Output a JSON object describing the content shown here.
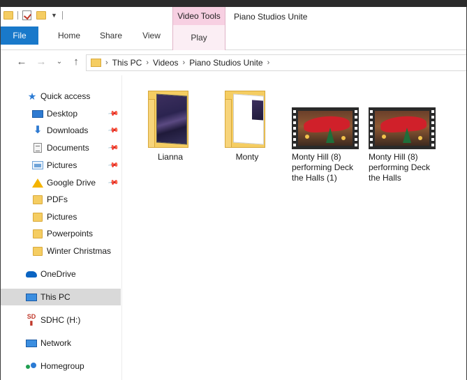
{
  "titlebar": {
    "video_tools_label": "Video Tools",
    "window_title": "Piano Studios Unite"
  },
  "ribbon": {
    "tabs": [
      "File",
      "Home",
      "Share",
      "View",
      "Play"
    ]
  },
  "address": {
    "crumbs": [
      "This PC",
      "Videos",
      "Piano Studios Unite"
    ]
  },
  "navpane": {
    "items": [
      {
        "label": "Quick access",
        "icon": "quick-access-star-icon"
      },
      {
        "label": "Desktop",
        "icon": "desktop-icon",
        "pinned": true
      },
      {
        "label": "Downloads",
        "icon": "downloads-icon",
        "pinned": true
      },
      {
        "label": "Documents",
        "icon": "documents-icon",
        "pinned": true
      },
      {
        "label": "Pictures",
        "icon": "pictures-icon",
        "pinned": true
      },
      {
        "label": "Google Drive",
        "icon": "google-drive-icon",
        "pinned": true
      },
      {
        "label": "PDFs",
        "icon": "folder-icon"
      },
      {
        "label": "Pictures",
        "icon": "folder-icon"
      },
      {
        "label": "Powerpoints",
        "icon": "folder-icon"
      },
      {
        "label": "Winter Christmas",
        "icon": "folder-icon"
      },
      {
        "label": "OneDrive",
        "icon": "onedrive-icon"
      },
      {
        "label": "This PC",
        "icon": "this-pc-icon",
        "selected": true
      },
      {
        "label": "SDHC (H:)",
        "icon": "sd-card-icon"
      },
      {
        "label": "Network",
        "icon": "network-icon"
      },
      {
        "label": "Homegroup",
        "icon": "homegroup-icon"
      }
    ]
  },
  "content": {
    "items": [
      {
        "name": "Lianna",
        "type": "folder"
      },
      {
        "name": "Monty",
        "type": "folder"
      },
      {
        "name": "Monty Hill (8) performing Deck the Halls (1)",
        "type": "video"
      },
      {
        "name": "Monty Hill (8) performing Deck the Halls",
        "type": "video"
      }
    ]
  },
  "colors": {
    "file_tab": "#1979ca",
    "video_tools": "#f7d0e2",
    "folder": "#f5cd62",
    "selected_nav": "#d9d9d9"
  }
}
